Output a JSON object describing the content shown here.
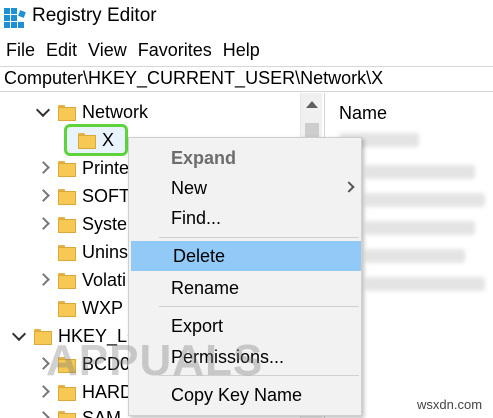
{
  "window": {
    "title": "Registry Editor"
  },
  "menu": [
    "File",
    "Edit",
    "View",
    "Favorites",
    "Help"
  ],
  "address": "Computer\\HKEY_CURRENT_USER\\Network\\X",
  "tree": {
    "rows": [
      {
        "label": "Network",
        "chevron": "down"
      },
      {
        "label": "X",
        "chevron": "none",
        "selected": true
      },
      {
        "label": "Printe",
        "chevron": "right"
      },
      {
        "label": "SOFT",
        "chevron": "right"
      },
      {
        "label": "Syste",
        "chevron": "right"
      },
      {
        "label": "Unins",
        "chevron": "none"
      },
      {
        "label": "Volati",
        "chevron": "right"
      },
      {
        "label": "WXP",
        "chevron": "none"
      },
      {
        "label": "HKEY_LC",
        "chevron": "down"
      },
      {
        "label": "BCD0",
        "chevron": "right"
      },
      {
        "label": "HARD",
        "chevron": "right"
      },
      {
        "label": "SAM",
        "chevron": "right"
      }
    ]
  },
  "right_pane": {
    "column_header": "Name"
  },
  "context_menu": {
    "items": [
      {
        "label": "Expand",
        "disabled": true
      },
      {
        "label": "New",
        "submenu": true
      },
      {
        "label": "Find..."
      },
      {
        "label": "Delete",
        "highlighted": true
      },
      {
        "label": "Rename"
      },
      {
        "label": "Export"
      },
      {
        "label": "Permissions..."
      },
      {
        "label": "Copy Key Name"
      }
    ]
  },
  "watermark": {
    "brand": "APPUALS",
    "site": "wsxdn.com"
  },
  "colors": {
    "selection_outline": "#5fd33a",
    "menu_highlight": "#91c9f7",
    "folder": "#f5c953"
  }
}
